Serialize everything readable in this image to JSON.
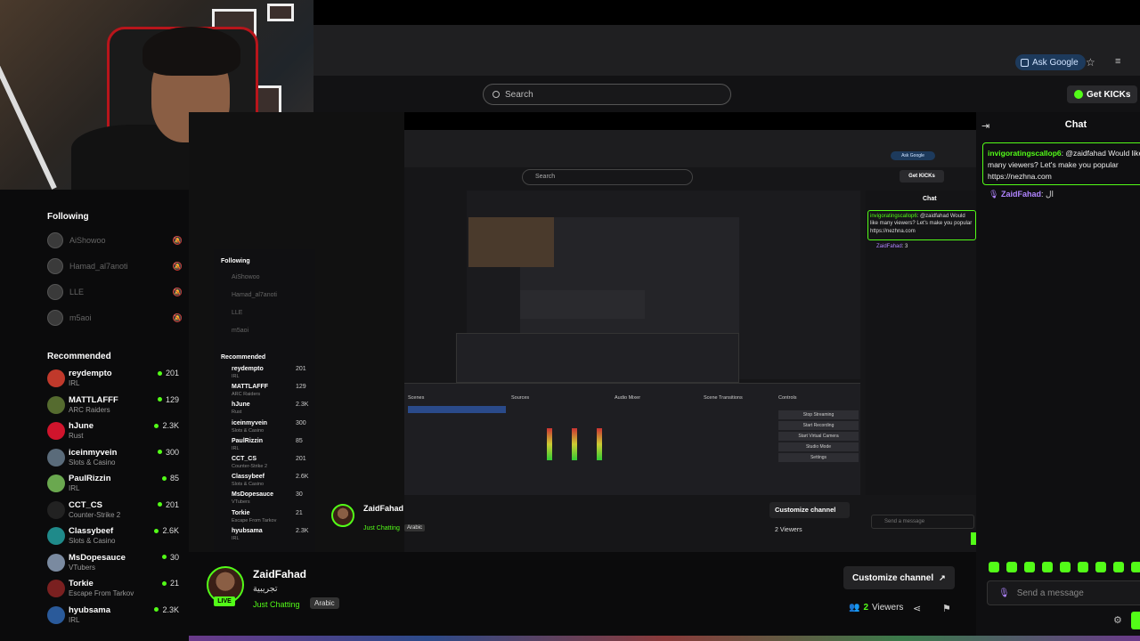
{
  "browser": {
    "ask_google": "Ask Google",
    "min_btn": "–"
  },
  "header": {
    "search_placeholder": "Search",
    "get_kicks": "Get KICKs"
  },
  "sidebar": {
    "following_title": "Following",
    "following": [
      {
        "name": "AiShowoo"
      },
      {
        "name": "Hamad_al7anoti"
      },
      {
        "name": "LLE"
      },
      {
        "name": "m5aoi"
      }
    ],
    "recommended_title": "Recommended",
    "recommended": [
      {
        "name": "reydempto",
        "category": "IRL",
        "viewers": "201",
        "color": "#c0392b"
      },
      {
        "name": "MATTLAFFF",
        "category": "ARC Raiders",
        "viewers": "129",
        "color": "#556b2f"
      },
      {
        "name": "hJune",
        "category": "Rust",
        "viewers": "2.3K",
        "color": "#d0142c"
      },
      {
        "name": "iceinmyvein",
        "category": "Slots & Casino",
        "viewers": "300",
        "color": "#5a6b7a"
      },
      {
        "name": "PaulRizzin",
        "category": "IRL",
        "viewers": "85",
        "color": "#6aa84f"
      },
      {
        "name": "CCT_CS",
        "category": "Counter-Strike 2",
        "viewers": "201",
        "color": "#222"
      },
      {
        "name": "Classybeef",
        "category": "Slots & Casino",
        "viewers": "2.6K",
        "color": "#1f8a8a"
      },
      {
        "name": "MsDopesauce",
        "category": "VTubers",
        "viewers": "30",
        "color": "#7a8aa0"
      },
      {
        "name": "Torkie",
        "category": "Escape From Tarkov",
        "viewers": "21",
        "color": "#7a2020"
      },
      {
        "name": "hyubsama",
        "category": "IRL",
        "viewers": "2.3K",
        "color": "#2a5a9a"
      }
    ]
  },
  "stream": {
    "streamer": "ZaidFahad",
    "title": "تجريبية",
    "live": "LIVE",
    "category": "Just Chatting",
    "language": "Arabic",
    "customize": "Customize channel",
    "viewers_count": "2",
    "viewers_label": "Viewers"
  },
  "chat": {
    "title": "Chat",
    "pinned_user": "invigoratingscallop6",
    "pinned_text": ": @zaidfahad Would like many viewers? Let's make you popular https://nezhna.com",
    "msg_user": "ZaidFahad",
    "msg_text": ": ال",
    "input_placeholder": "Send a message"
  },
  "nested": {
    "following_title": "Following",
    "recommended_title": "Recommended",
    "chat_title": "Chat",
    "search_placeholder": "Search",
    "get_kicks": "Get KICKs",
    "ask_google": "Ask Google",
    "streamer": "ZaidFahad",
    "category": "Just Chatting",
    "language": "Arabic",
    "customize": "Customize channel",
    "viewers": "2 Viewers",
    "input_placeholder": "Send a message",
    "pinned_user": "invigoratingscallop6",
    "pinned_text": ": @zaidfahad Would like many viewers? Let's make you popular https://nezhna.com",
    "msg_user": "ZaidFahad",
    "msg_text": ": 3",
    "following": [
      "AiShowoo",
      "Hamad_al7anoti",
      "LLE",
      "m5aoi"
    ],
    "recommended": [
      {
        "name": "reydempto",
        "category": "IRL",
        "viewers": "201"
      },
      {
        "name": "MATTLAFFF",
        "category": "ARC Raiders",
        "viewers": "129"
      },
      {
        "name": "hJune",
        "category": "Rust",
        "viewers": "2.3K"
      },
      {
        "name": "iceinmyvein",
        "category": "Slots & Casino",
        "viewers": "300"
      },
      {
        "name": "PaulRizzin",
        "category": "IRL",
        "viewers": "85"
      },
      {
        "name": "CCT_CS",
        "category": "Counter-Strike 2",
        "viewers": "201"
      },
      {
        "name": "Classybeef",
        "category": "Slots & Casino",
        "viewers": "2.6K"
      },
      {
        "name": "MsDopesauce",
        "category": "VTubers",
        "viewers": "30"
      },
      {
        "name": "Torkie",
        "category": "Escape From Tarkov",
        "viewers": "21"
      },
      {
        "name": "hyubsama",
        "category": "IRL",
        "viewers": "2.3K"
      }
    ],
    "obs_panels": [
      "Scenes",
      "Sources",
      "Audio Mixer",
      "Scene Transitions",
      "Controls"
    ],
    "obs_controls": [
      "Stop Streaming",
      "Start Recording",
      "Start Virtual Camera",
      "Studio Mode",
      "Settings"
    ]
  },
  "colors": {
    "accent": "#53fc18",
    "background": "#0b0b0c"
  }
}
